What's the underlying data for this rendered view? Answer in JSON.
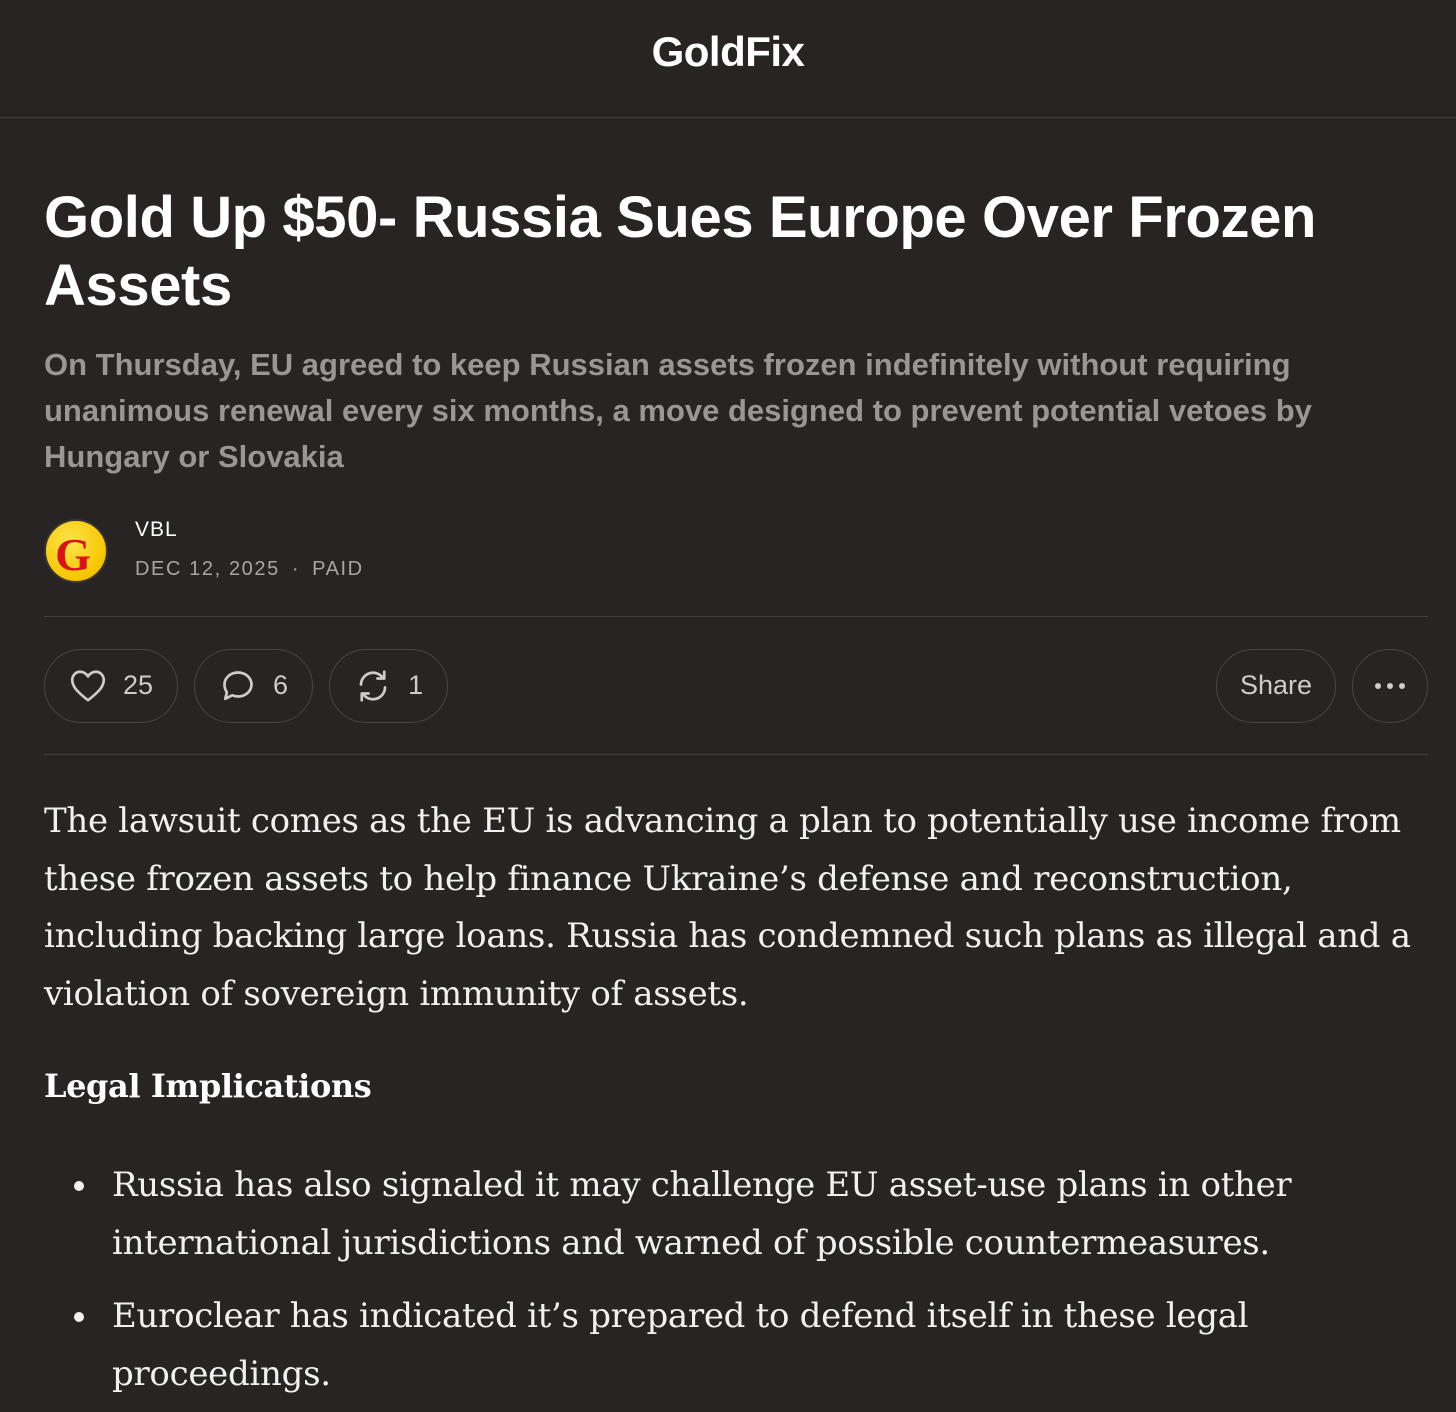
{
  "header": {
    "publication": "GoldFix"
  },
  "post": {
    "title": "Gold Up $50- Russia Sues Europe Over Frozen Assets",
    "subtitle": "On Thursday, EU agreed to keep Russian assets frozen indefinitely without requiring unanimous renewal every six months, a move designed to prevent potential vetoes by Hungary or Slovakia",
    "author": "VBL",
    "avatar_letter": "G",
    "date": "DEC 12, 2025",
    "meta_separator": "·",
    "access": "PAID"
  },
  "actions": {
    "likes": "25",
    "comments": "6",
    "restacks": "1",
    "share_label": "Share",
    "icons": [
      "heart-icon",
      "comment-icon",
      "restack-icon",
      "more-icon"
    ]
  },
  "body": {
    "paragraph_1": "The lawsuit comes as the EU is advancing a plan to potentially use income from these frozen assets to help finance Ukraine’s defense and reconstruction, including backing large loans. Russia has condemned such plans as illegal and a violation of sovereign immunity of assets.",
    "heading_1": "Legal Implications",
    "bullets": [
      "Russia has also signaled it may challenge EU asset-use plans in other international jurisdictions and warned of possible countermeasures.",
      "Euroclear has indicated it’s prepared to defend itself in these legal proceedings."
    ]
  },
  "colors": {
    "background": "#282424",
    "text": "#ffffff",
    "muted": "#9a9696",
    "avatar_yellow": "#f7c600",
    "avatar_red": "#d81414"
  }
}
